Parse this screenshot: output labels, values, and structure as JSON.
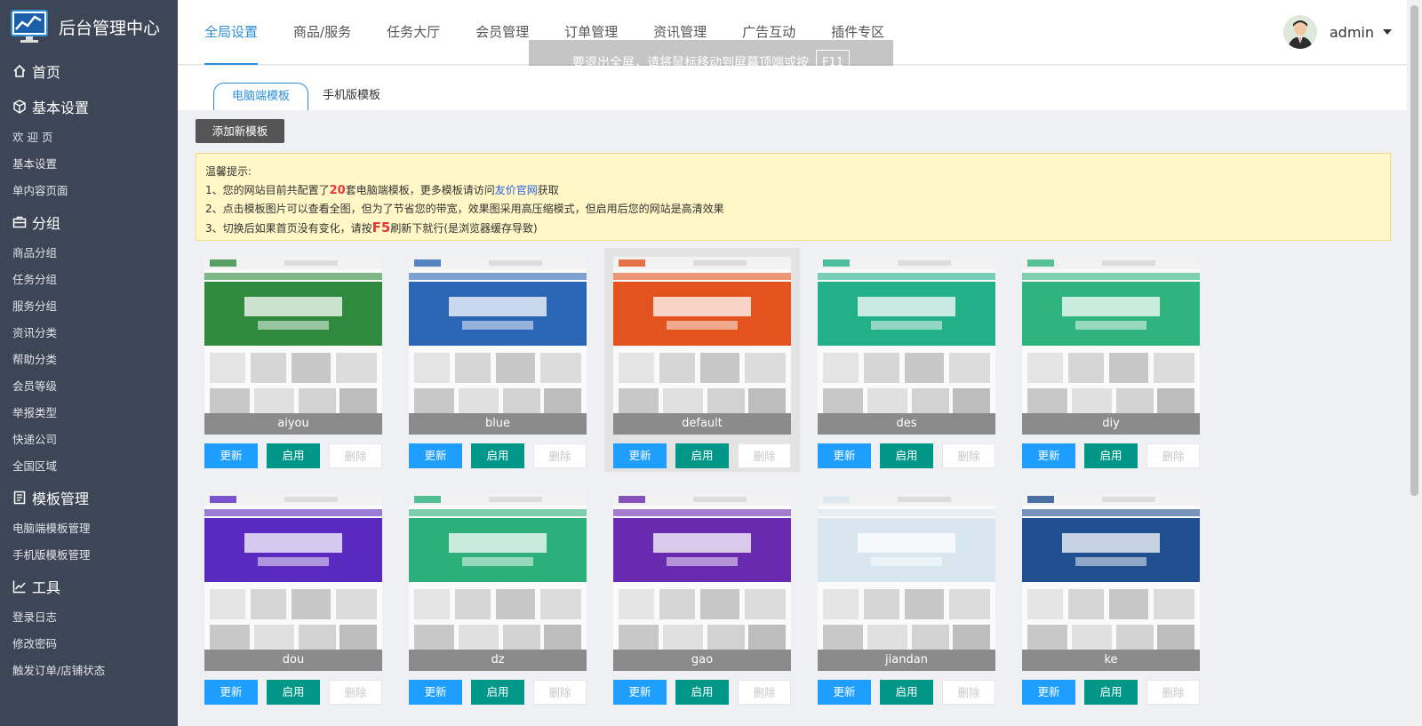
{
  "app": {
    "title": "后台管理中心"
  },
  "sidebar": {
    "home": "首页",
    "sections": [
      {
        "title": "基本设置",
        "icon": "cube-icon",
        "items": [
          "欢 迎 页",
          "基本设置",
          "单内容页面"
        ]
      },
      {
        "title": "分组",
        "icon": "briefcase-icon",
        "items": [
          "商品分组",
          "任务分组",
          "服务分组",
          "资讯分类",
          "帮助分类",
          "会员等级",
          "举报类型",
          "快递公司",
          "全国区域"
        ]
      },
      {
        "title": "模板管理",
        "icon": "document-icon",
        "items": [
          "电脑端模板管理",
          "手机版模板管理"
        ]
      },
      {
        "title": "工具",
        "icon": "chart-icon",
        "items": [
          "登录日志",
          "修改密码",
          "触发订单/店铺状态"
        ]
      }
    ]
  },
  "topnav": [
    "全局设置",
    "商品/服务",
    "任务大厅",
    "会员管理",
    "订单管理",
    "资讯管理",
    "广告互动",
    "插件专区"
  ],
  "user": {
    "name": "admin"
  },
  "toast": {
    "text": "要退出全屏，请将鼠标移动到屏幕顶端或按",
    "key": "F11"
  },
  "tabs": [
    "电脑端模板",
    "手机版模板"
  ],
  "add_button": "添加新模板",
  "tip": {
    "title": "温馨提示:",
    "line1_a": "1、您的网站目前共配置了",
    "count": "20",
    "line1_b": "套电脑端模板，更多模板请访问",
    "link": "友价官网",
    "line1_c": "获取",
    "line2": "2、点击模板图片可以查看全图，但为了节省您的带宽，效果图采用高压缩模式，但启用后您的网站是高清效果",
    "line3_a": "3、切换后如果首页没有变化，请按",
    "key": "F5",
    "line3_b": "刷新下就行(是浏览器缓存导致)"
  },
  "buttons": {
    "update": "更新",
    "enable": "启用",
    "delete": "删除"
  },
  "templates": [
    {
      "name": "aiyou",
      "color": "#2f8a3e"
    },
    {
      "name": "blue",
      "color": "#2a66b4"
    },
    {
      "name": "default",
      "color": "#e2531d"
    },
    {
      "name": "des",
      "color": "#22b088"
    },
    {
      "name": "diy",
      "color": "#2fb37f"
    },
    {
      "name": "dou",
      "color": "#5a2ac0"
    },
    {
      "name": "dz",
      "color": "#2bb07a"
    },
    {
      "name": "gao",
      "color": "#6a2ab0"
    },
    {
      "name": "jiandan",
      "color": "#d8e6f0"
    },
    {
      "name": "ke",
      "color": "#1f4f8e"
    }
  ]
}
